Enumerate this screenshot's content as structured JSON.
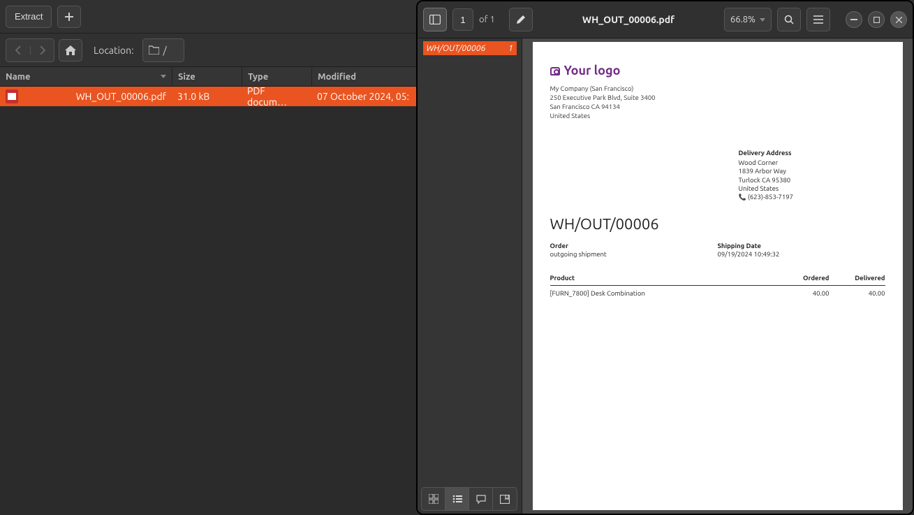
{
  "fm": {
    "extract_label": "Extract",
    "location_label": "Location:",
    "path": "/",
    "cols": {
      "name": "Name",
      "size": "Size",
      "type": "Type",
      "modified": "Modified"
    },
    "row": {
      "name": "WH_OUT_00006.pdf",
      "size": "31.0 kB",
      "type": "PDF docum…",
      "modified": "07 October 2024, 05:"
    }
  },
  "viewer": {
    "page_current": "1",
    "page_of": "of 1",
    "title": "WH_OUT_00006.pdf",
    "zoom": "66.8%",
    "thumb_label": "WH/OUT/00006",
    "thumb_page": "1"
  },
  "doc": {
    "logo_text": "Your logo",
    "company": {
      "name": "My Company (San Francisco)",
      "addr1": "250 Executive Park Blvd, Suite 3400",
      "addr2": "San Francisco CA 94134",
      "country": "United States"
    },
    "delivery": {
      "title": "Delivery Address",
      "name": "Wood Corner",
      "addr1": "1839 Arbor Way",
      "addr2": "Turlock CA 95380",
      "country": "United States",
      "phone": "(623)-853-7197"
    },
    "doc_number": "WH/OUT/00006",
    "order": {
      "label": "Order",
      "value": "outgoing shipment"
    },
    "shipping": {
      "label": "Shipping Date",
      "value": "09/19/2024 10:49:32"
    },
    "table": {
      "col_product": "Product",
      "col_ordered": "Ordered",
      "col_delivered": "Delivered",
      "row": {
        "product": "[FURN_7800] Desk Combination",
        "ordered": "40.00",
        "delivered": "40.00"
      }
    }
  }
}
